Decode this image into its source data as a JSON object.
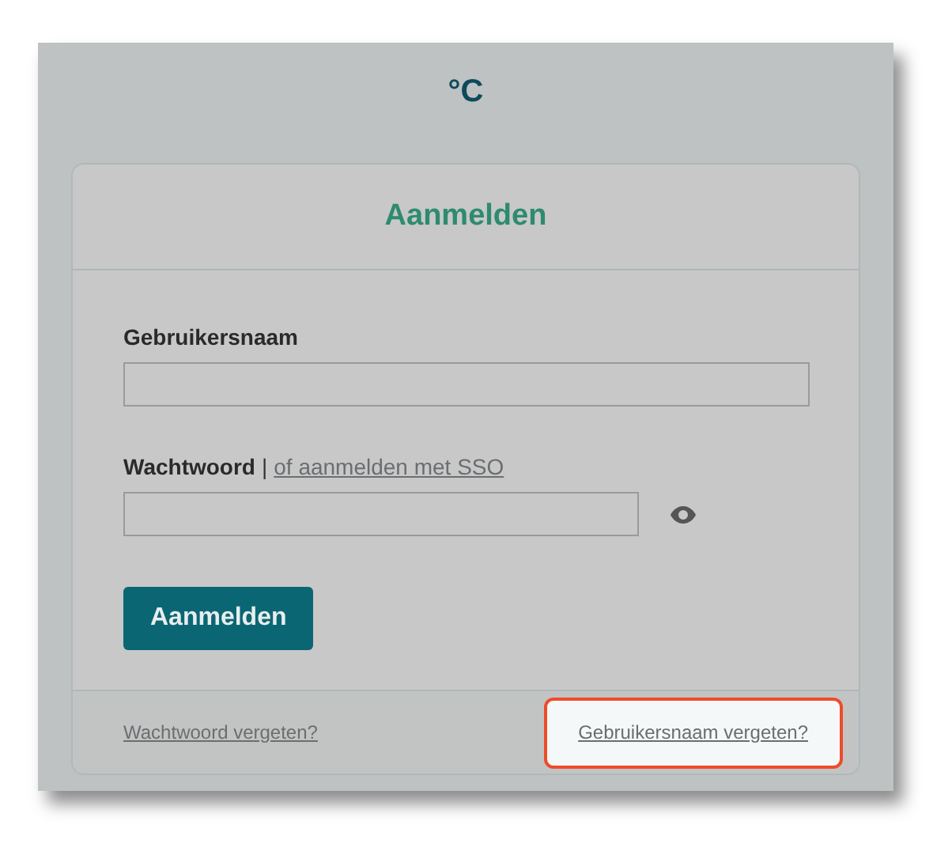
{
  "logo": "°C",
  "card": {
    "title": "Aanmelden",
    "fields": [
      {
        "label": "Gebruikersnaam",
        "kind": "text"
      },
      {
        "label": "Wachtwoord",
        "separator": "|",
        "link": "of aanmelden met SSO",
        "kind": "password"
      }
    ],
    "submit": "Aanmelden"
  },
  "footer_links": [
    {
      "label": "Wachtwoord vergeten?",
      "highlighted": false
    },
    {
      "label": "Gebruikersnaam vergeten?",
      "highlighted": true
    }
  ]
}
